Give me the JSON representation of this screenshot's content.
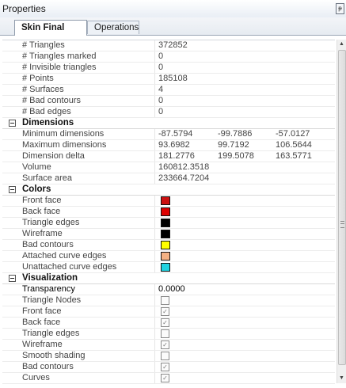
{
  "window": {
    "title": "Properties",
    "pin_glyph": "ᵽ"
  },
  "tabs": [
    {
      "label": "Skin Final",
      "active": true
    },
    {
      "label": "Operations",
      "active": false
    }
  ],
  "general_rows": [
    {
      "label": "# Triangles",
      "value": "372852"
    },
    {
      "label": "# Triangles marked",
      "value": "0"
    },
    {
      "label": "# Invisible triangles",
      "value": "0"
    },
    {
      "label": "# Points",
      "value": "185108"
    },
    {
      "label": "# Surfaces",
      "value": "4"
    },
    {
      "label": "# Bad contours",
      "value": "0"
    },
    {
      "label": "# Bad edges",
      "value": "0"
    }
  ],
  "dimensions": {
    "header": "Dimensions",
    "rows": [
      {
        "label": "Minimum dimensions",
        "x": "-87.5794",
        "y": "-99.7886",
        "z": "-57.0127"
      },
      {
        "label": "Maximum dimensions",
        "x": "93.6982",
        "y": "99.7192",
        "z": "106.5644"
      },
      {
        "label": "Dimension delta",
        "x": "181.2776",
        "y": "199.5078",
        "z": "163.5771"
      },
      {
        "label": "Volume",
        "x": "160812.3518",
        "y": "",
        "z": ""
      },
      {
        "label": "Surface area",
        "x": "233664.7204",
        "y": "",
        "z": ""
      }
    ]
  },
  "colors": {
    "header": "Colors",
    "rows": [
      {
        "label": "Front face",
        "color": "#cc1111"
      },
      {
        "label": "Back face",
        "color": "#dd0000"
      },
      {
        "label": "Triangle edges",
        "color": "#000000"
      },
      {
        "label": "Wireframe",
        "color": "#000000"
      },
      {
        "label": "Bad contours",
        "color": "#ffff00"
      },
      {
        "label": "Attached curve edges",
        "color": "#f4b183"
      },
      {
        "label": "Unattached curve edges",
        "color": "#22d3e0"
      }
    ]
  },
  "visualization": {
    "header": "Visualization",
    "transparency_label": "Transparency",
    "transparency_value": "0.0000",
    "rows": [
      {
        "label": "Triangle Nodes",
        "checked": false
      },
      {
        "label": "Front face",
        "checked": true
      },
      {
        "label": "Back face",
        "checked": true
      },
      {
        "label": "Triangle edges",
        "checked": false
      },
      {
        "label": "Wireframe",
        "checked": true
      },
      {
        "label": "Smooth shading",
        "checked": false
      },
      {
        "label": "Bad contours",
        "checked": true
      },
      {
        "label": "Curves",
        "checked": true
      }
    ]
  },
  "scrollbar": {
    "up_glyph": "▲",
    "down_glyph": "▼"
  }
}
